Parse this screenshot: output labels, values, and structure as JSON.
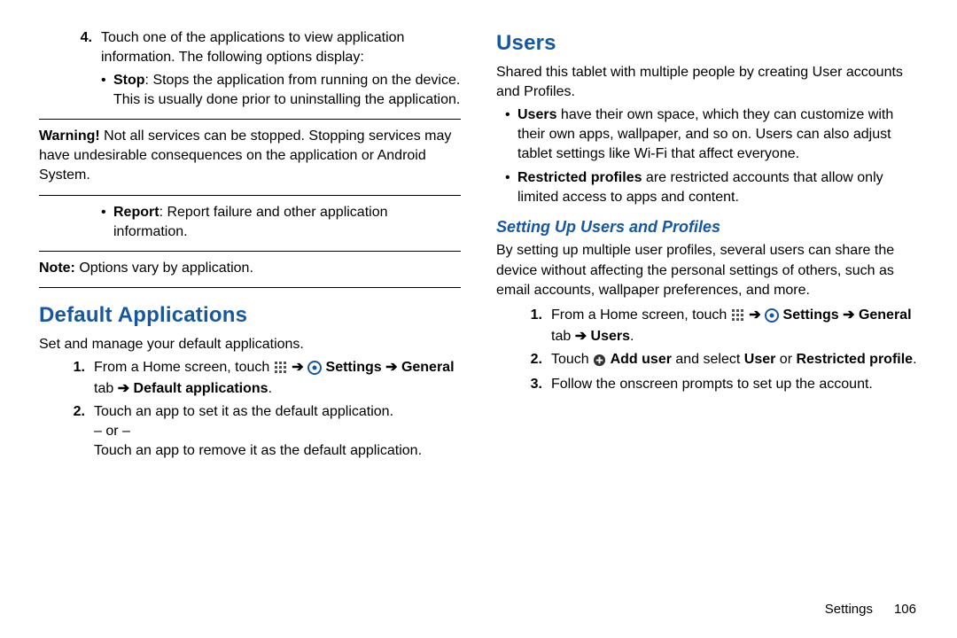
{
  "left": {
    "step4": {
      "num": "4.",
      "intro": "Touch one of the applications to view application information. The following options display:",
      "stop_label": "Stop",
      "stop_text": ": Stops the application from running on the device. This is usually done prior to uninstalling the application.",
      "warn_label": "Warning!",
      "warn_text": " Not all services can be stopped. Stopping services may have undesirable consequences on the application or Android System.",
      "report_label": "Report",
      "report_text": ": Report failure and other application information.",
      "note_label": "Note:",
      "note_text": " Options vary by application."
    },
    "default_apps": {
      "heading": "Default Applications",
      "intro": "Set and manage your default applications.",
      "s1_num": "1.",
      "s1_pre": "From a Home screen, touch ",
      "s1_settings": " Settings ",
      "s1_general": "General",
      "s1_tab": " tab ",
      "s1_target": " Default applications",
      "s2_num": "2.",
      "s2_a": "Touch an app to set it as the default application.",
      "s2_or": "– or –",
      "s2_b": "Touch an app to remove it as the default application."
    }
  },
  "right": {
    "users": {
      "heading": "Users",
      "intro": "Shared this tablet with multiple people by creating User accounts and Profiles.",
      "b1_label": "Users",
      "b1_text": " have their own space, which they can customize with their own apps, wallpaper, and so on. Users can also adjust tablet settings like Wi-Fi that affect everyone.",
      "b2_label": "Restricted profiles",
      "b2_text": " are restricted accounts that allow only limited access to apps and content."
    },
    "setup": {
      "heading": "Setting Up Users and Profiles",
      "intro": "By setting up multiple user profiles, several users can share the device without affecting the personal settings of others, such as email accounts, wallpaper preferences, and more.",
      "s1_num": "1.",
      "s1_pre": "From a Home screen, touch ",
      "s1_settings": " Settings ",
      "s1_general": "General",
      "s1_tab": " tab ",
      "s1_target": " Users",
      "s2_num": "2.",
      "s2_pre": "Touch ",
      "s2_add": " Add user",
      "s2_mid": " and select ",
      "s2_user": "User",
      "s2_or": " or ",
      "s2_rp": "Restricted profile",
      "s3_num": "3.",
      "s3_text": "Follow the onscreen prompts to set up the account."
    }
  },
  "footer": {
    "section": "Settings",
    "page": "106"
  },
  "glyphs": {
    "arrow": "➔",
    "bullet": "•",
    "period": "."
  }
}
